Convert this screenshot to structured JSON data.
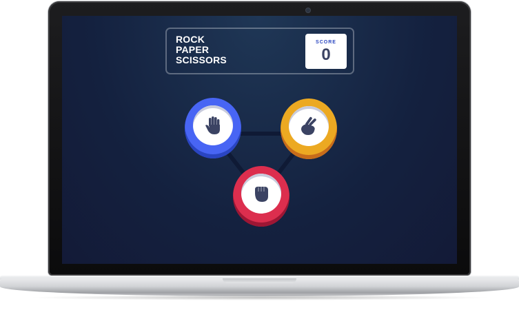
{
  "game": {
    "title_lines": [
      "ROCK",
      "PAPER",
      "SCISSORS"
    ],
    "score_label": "SCORE",
    "score_value": "0"
  },
  "tokens": [
    {
      "name": "paper",
      "icon": "hand-open-icon",
      "ring_color": "#4865f4"
    },
    {
      "name": "scissors",
      "icon": "hand-scissors-icon",
      "ring_color": "#eca922"
    },
    {
      "name": "rock",
      "icon": "hand-fist-icon",
      "ring_color": "#dc2e4e"
    }
  ],
  "colors": {
    "background": "#14213f",
    "header_border": "rgba(255,255,255,0.3)",
    "score_label": "#2a46c0",
    "score_value": "#3b4363"
  }
}
